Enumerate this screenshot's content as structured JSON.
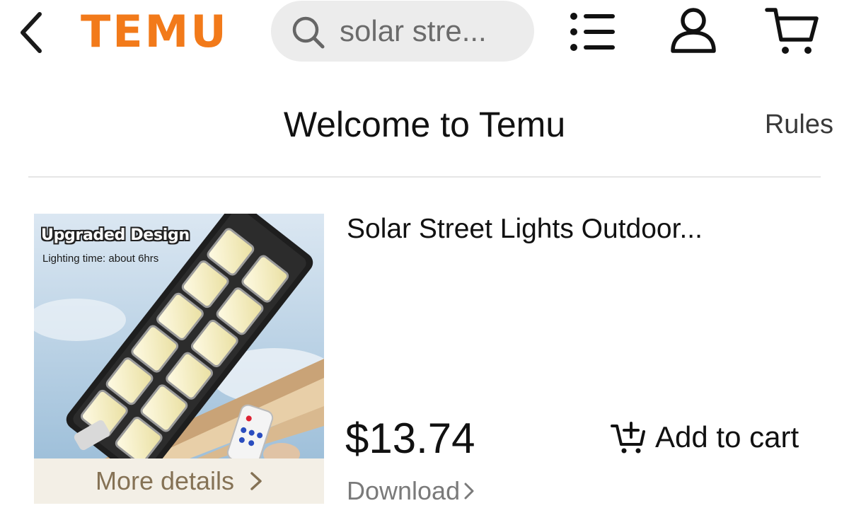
{
  "header": {
    "logo_text": "TEMU",
    "brand_color": "#F27A1A",
    "search": {
      "value": "solar stre..."
    },
    "icons": {
      "back": "chevron-left-icon",
      "search": "search-icon",
      "menu": "list-icon",
      "account": "user-icon",
      "cart": "cart-icon"
    }
  },
  "title_bar": {
    "title": "Welcome to Temu",
    "rules_label": "Rules"
  },
  "product": {
    "image": {
      "badge": "Upgraded Design",
      "caption": "Lighting time: about 6hrs"
    },
    "title": "Solar Street Lights Outdoor...",
    "price": "$13.74",
    "add_to_cart_label": "Add to cart",
    "more_details_label": "More details",
    "download_label": "Download",
    "colors": {
      "more_details_bg": "#F3EFE6",
      "more_details_text": "#857255"
    }
  }
}
